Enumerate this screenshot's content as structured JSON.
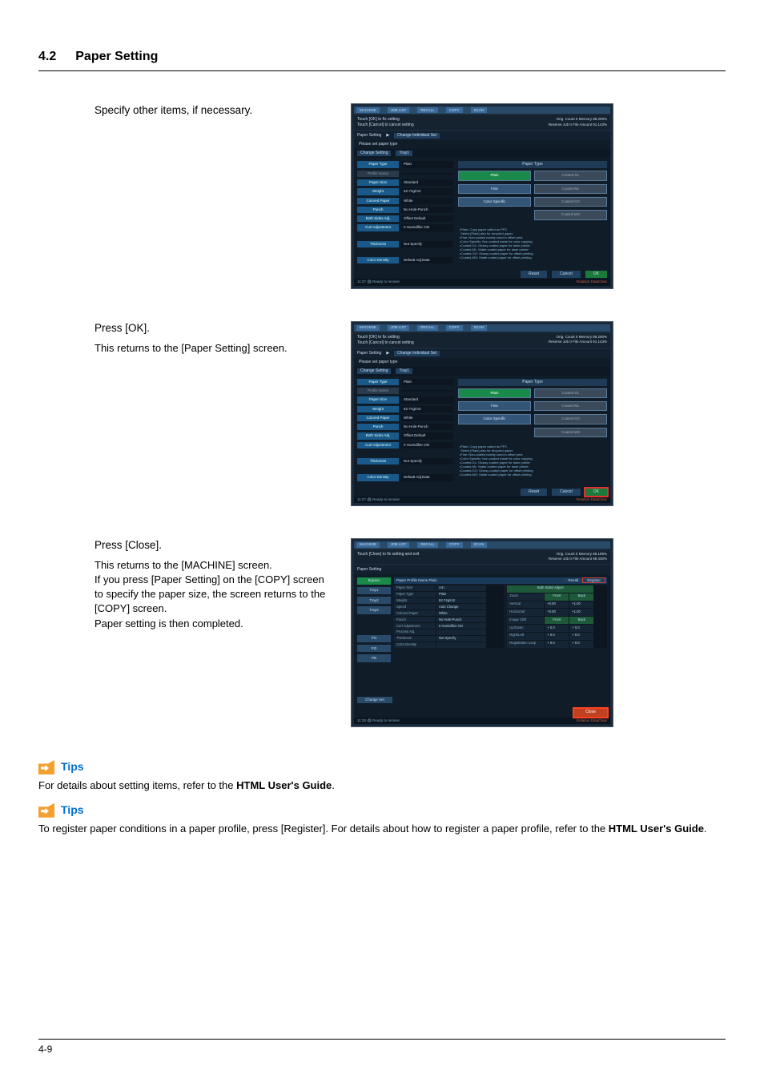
{
  "header": {
    "section_num": "4.2",
    "section_title": "Paper Setting"
  },
  "steps": {
    "s1": {
      "head": "Specify other items, if necessary."
    },
    "s2": {
      "head": "Press [OK].",
      "body": "This returns to the [Paper Setting] screen."
    },
    "s3": {
      "head": "Press [Close].",
      "body1": "This returns to the [MACHINE] screen.",
      "body2": "If you press [Paper Setting] on the [COPY] screen to specify the paper size, the screen returns to the [COPY] screen.",
      "body3": "Paper setting is then completed."
    }
  },
  "ss_common": {
    "tabs": {
      "machine": "MACHINE",
      "joblist": "JOB LIST",
      "recall": "RECALL",
      "copy": "COPY",
      "scan": "SCAN"
    },
    "info_msg": "Touch [OK] to fix setting\nTouch [Cancel] to cancel setting",
    "orig_label": "Orig. Count",
    "orig_val": "0",
    "mem_label": "Memory",
    "mem_val": "88.200%",
    "reserve_label": "Reserve Job",
    "reserve_val": "0",
    "file_label": "File Amount",
    "file_val": "91.143%",
    "crumb": {
      "a": "Paper Setting",
      "b": "Change Individual Set"
    },
    "prompt": "Please set paper type",
    "sub_crumb": {
      "a": "Change Setting",
      "b": "Tray1"
    },
    "left": {
      "paper_type": {
        "k": "Paper Type",
        "v": "Plain"
      },
      "profile": {
        "k": "Profile Name",
        "v": ""
      },
      "paper_size": {
        "k": "Paper Size",
        "v": "Standard"
      },
      "weight": {
        "k": "Weight",
        "v": "62-74g/m2"
      },
      "colored": {
        "k": "Colored Paper",
        "v": "White"
      },
      "punch": {
        "k": "Punch",
        "v": "No Hole-Punch"
      },
      "both": {
        "k": "Both Sides Adj.",
        "v": "Offset Default"
      },
      "curl": {
        "k": "Curl Adjustment",
        "v": "0  Humidifier ON"
      },
      "thick": {
        "k": "Thickness",
        "v": "Not Specify"
      },
      "color_density": {
        "k": "Color Density",
        "v": "Default Adj.Data"
      }
    },
    "right_head": "Paper Type",
    "type_buttons": {
      "plain": "Plain",
      "coated_gl": "Coated-GL",
      "fine": "Fine",
      "coated_ml": "Coated-ML",
      "color_spec": "Color Specific",
      "coated_go": "Coated-GO",
      "coated_mo": "Coated-MO"
    },
    "note": "•Plain: Copy paper called as PPC\n Select [Plain] also for recycled paper.\n•Fine: Non-coated mainly used in offset print\n•Color Specific: Non-coated made for color copying\n•Coated-GL: Glossy coated paper for laser printer\n•Coated-ML: Matte coated paper for laser printer\n•Coated-GO: Glossy coated paper for offset printing\n•Coated-MO: Matte coated paper for offset printing",
    "bottom": {
      "reset": "Reset",
      "cancel": "Cancel",
      "ok": "OK"
    },
    "status": {
      "time": "11:27",
      "ready": "Ready to receive",
      "rt1": "Rotation",
      "rt2": "DataClear"
    }
  },
  "ss3": {
    "info_msg": "Touch [Close] to fix setting and exit",
    "orig_val": "0",
    "mem_val": "88.199%",
    "reserve_val": "0",
    "file_val": "98.430%",
    "crumb": "Paper Setting",
    "side": {
      "bypass": "Bypass",
      "tray1": "Tray1",
      "tray2": "Tray2",
      "tray3": "Tray3",
      "pi1": "PI1",
      "pi2": "PI2",
      "pb": "PB"
    },
    "header_row": {
      "profile": "Paper Profile Name",
      "profile_v": "Plain",
      "recall": "Recall",
      "register": "Register"
    },
    "left_table": {
      "paper_size": {
        "k": "Paper Size",
        "v": "A4□"
      },
      "paper_type": {
        "k": "Paper Type",
        "v": "Plain"
      },
      "weight": {
        "k": "Weight",
        "v": "62-74g/m2"
      },
      "speed": {
        "k": "Speed",
        "v": "Auto Change"
      },
      "colored": {
        "k": "Colored Paper",
        "v": "White"
      },
      "punch": {
        "k": "Punch",
        "v": "No Hole-Punch"
      },
      "curl": {
        "k": "Curl Adjustment",
        "v": "0  Humidifier ON"
      },
      "process": {
        "k": "Process Adj.",
        "v": ""
      },
      "thick": {
        "k": "Thickness",
        "v": "Not Specify"
      },
      "density": {
        "k": "Color Density",
        "v": ""
      }
    },
    "right_table": {
      "head": {
        "a": "Both Sides Adjust",
        "f": "Front",
        "b": "Back"
      },
      "zoom": {
        "k": "Zoom",
        "f": "",
        "b": ""
      },
      "vertical": {
        "k": "Vertical",
        "f": "+0.00",
        "b": "+1.00"
      },
      "horizontal": {
        "k": "Horizontal",
        "f": "+0.00",
        "b": "+1.00"
      },
      "imgshift": {
        "k": "Image Shift",
        "f": "Front",
        "b": "Back"
      },
      "updown": {
        "k": "Up/Down",
        "f": "+ 0.0",
        "b": "+ 0.0"
      },
      "rightleft": {
        "k": "Right/Left",
        "f": "+ 0.0",
        "b": "+ 0.0"
      },
      "regloop": {
        "k": "Registration Loop",
        "f": "+ 0.0",
        "b": "+ 0.0"
      }
    },
    "change_set": "Change Set",
    "close": "Close",
    "status_time": "11:28"
  },
  "tips1": {
    "label": "Tips",
    "body_a": "For details about setting items, refer to the ",
    "body_b": "HTML User's Guide",
    "body_c": "."
  },
  "tips2": {
    "label": "Tips",
    "body_a": "To register paper conditions in a paper profile, press [Register]. For details about how to register a paper profile, refer to the ",
    "body_b": "HTML User's Guide",
    "body_c": "."
  },
  "footer": {
    "page": "4-9"
  }
}
